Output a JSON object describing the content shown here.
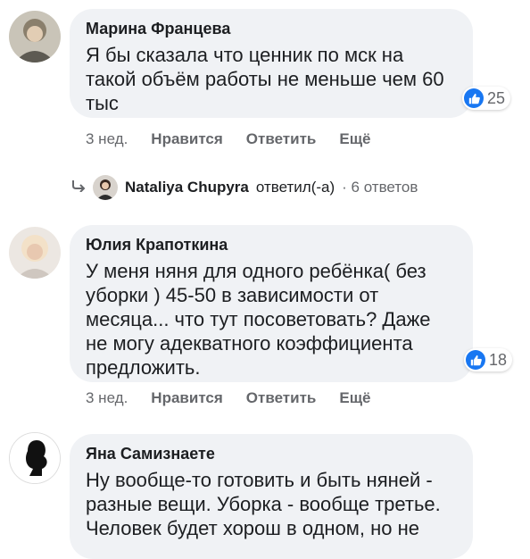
{
  "comments": [
    {
      "author": "Марина Францева",
      "text": "Я бы сказала что ценник по мск на такой объём работы не меньше чем 60 тыс",
      "reactions": "25",
      "time": "3 нед.",
      "like": "Нравится",
      "reply": "Ответить",
      "more": "Ещё"
    },
    {
      "author": "Юлия Крапоткина",
      "text": "У меня няня для одного ребёнка( без уборки ) 45-50 в зависимости от месяца... что тут посоветовать? Даже не могу адекватного коэффициента предложить.",
      "reactions": "18",
      "time": "3 нед.",
      "like": "Нравится",
      "reply": "Ответить",
      "more": "Ещё"
    },
    {
      "author": "Яна Самизнаете",
      "text": "Ну вообще-то готовить и быть няней - разные вещи. Уборка - вообще третье. Человек будет хорош в одном, но не"
    }
  ],
  "reply_summary": {
    "name": "Nataliya Chupyra",
    "verb": "ответил(-а)",
    "count": "· 6 ответов"
  },
  "colors": {
    "like": "#1877f2",
    "bubble": "#f0f2f5",
    "muted": "#65676b"
  }
}
